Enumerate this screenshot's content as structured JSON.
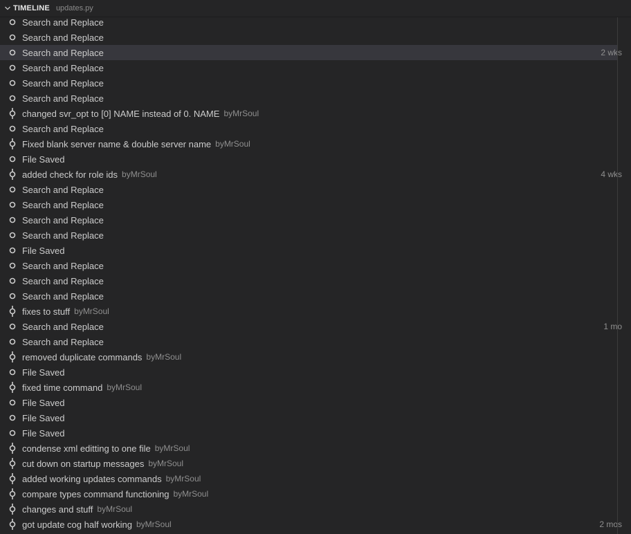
{
  "header": {
    "title": "TIMELINE",
    "file": "updates.py"
  },
  "selected_index": 2,
  "items": [
    {
      "label": "Search and Replace",
      "kind": "local",
      "desc": "",
      "time": ""
    },
    {
      "label": "Search and Replace",
      "kind": "local",
      "desc": "",
      "time": ""
    },
    {
      "label": "Search and Replace",
      "kind": "local",
      "desc": "",
      "time": "2 wks"
    },
    {
      "label": "Search and Replace",
      "kind": "local",
      "desc": "",
      "time": ""
    },
    {
      "label": "Search and Replace",
      "kind": "local",
      "desc": "",
      "time": ""
    },
    {
      "label": "Search and Replace",
      "kind": "local",
      "desc": "",
      "time": ""
    },
    {
      "label": "changed svr_opt to [0] NAME instead of 0. NAME",
      "kind": "commit",
      "desc": "byMrSoul",
      "time": ""
    },
    {
      "label": "Search and Replace",
      "kind": "local",
      "desc": "",
      "time": ""
    },
    {
      "label": "Fixed blank server name & double server name",
      "kind": "commit",
      "desc": "byMrSoul",
      "time": ""
    },
    {
      "label": "File Saved",
      "kind": "local",
      "desc": "",
      "time": ""
    },
    {
      "label": "added check for role ids",
      "kind": "commit",
      "desc": "byMrSoul",
      "time": "4 wks"
    },
    {
      "label": "Search and Replace",
      "kind": "local",
      "desc": "",
      "time": ""
    },
    {
      "label": "Search and Replace",
      "kind": "local",
      "desc": "",
      "time": ""
    },
    {
      "label": "Search and Replace",
      "kind": "local",
      "desc": "",
      "time": ""
    },
    {
      "label": "Search and Replace",
      "kind": "local",
      "desc": "",
      "time": ""
    },
    {
      "label": "File Saved",
      "kind": "local",
      "desc": "",
      "time": ""
    },
    {
      "label": "Search and Replace",
      "kind": "local",
      "desc": "",
      "time": ""
    },
    {
      "label": "Search and Replace",
      "kind": "local",
      "desc": "",
      "time": ""
    },
    {
      "label": "Search and Replace",
      "kind": "local",
      "desc": "",
      "time": ""
    },
    {
      "label": "fixes to stuff",
      "kind": "commit",
      "desc": "byMrSoul",
      "time": ""
    },
    {
      "label": "Search and Replace",
      "kind": "local",
      "desc": "",
      "time": "1 mo"
    },
    {
      "label": "Search and Replace",
      "kind": "local",
      "desc": "",
      "time": ""
    },
    {
      "label": "removed duplicate commands",
      "kind": "commit",
      "desc": "byMrSoul",
      "time": ""
    },
    {
      "label": "File Saved",
      "kind": "local",
      "desc": "",
      "time": ""
    },
    {
      "label": "fixed time command",
      "kind": "commit",
      "desc": "byMrSoul",
      "time": ""
    },
    {
      "label": "File Saved",
      "kind": "local",
      "desc": "",
      "time": ""
    },
    {
      "label": "File Saved",
      "kind": "local",
      "desc": "",
      "time": ""
    },
    {
      "label": "File Saved",
      "kind": "local",
      "desc": "",
      "time": ""
    },
    {
      "label": "condense xml editting to one file",
      "kind": "commit",
      "desc": "byMrSoul",
      "time": ""
    },
    {
      "label": "cut down on startup messages",
      "kind": "commit",
      "desc": "byMrSoul",
      "time": ""
    },
    {
      "label": "added working updates commands",
      "kind": "commit",
      "desc": "byMrSoul",
      "time": ""
    },
    {
      "label": "compare types command functioning",
      "kind": "commit",
      "desc": "byMrSoul",
      "time": ""
    },
    {
      "label": "changes and stuff",
      "kind": "commit",
      "desc": "byMrSoul",
      "time": ""
    },
    {
      "label": "got update cog half working",
      "kind": "commit",
      "desc": "byMrSoul",
      "time": "2 mos"
    }
  ],
  "colors": {
    "background": "#252526",
    "selected": "#37373d",
    "text": "#cccccc",
    "muted": "#8f8f8f"
  }
}
